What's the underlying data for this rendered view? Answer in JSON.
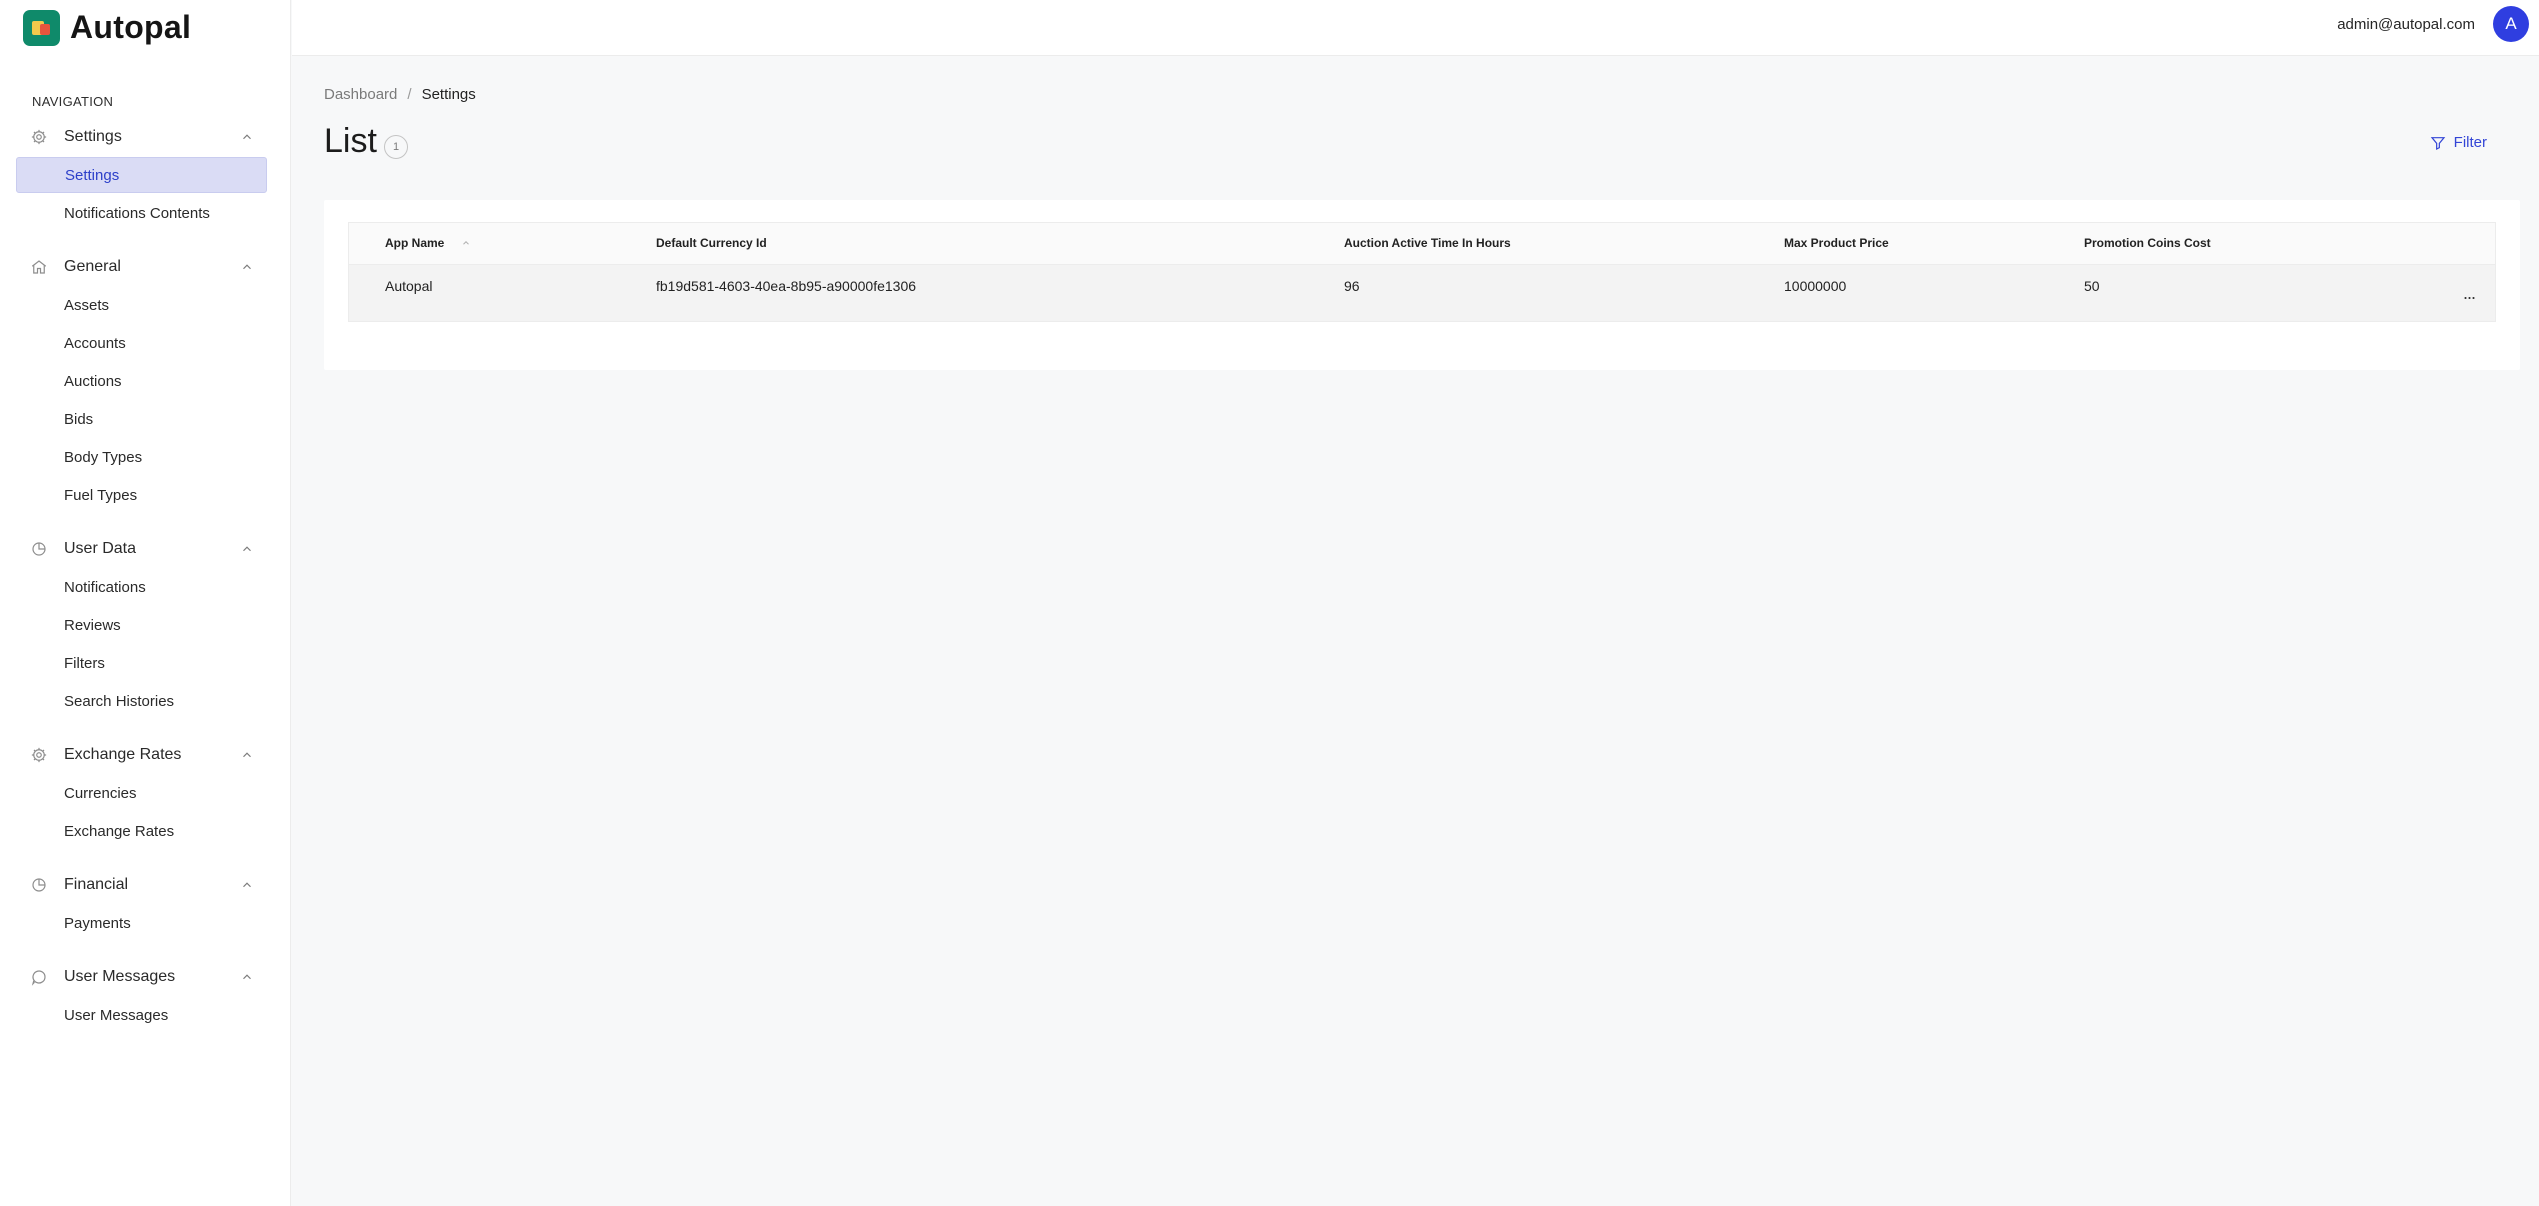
{
  "brand": {
    "name": "Autopal"
  },
  "sidebar": {
    "heading": "NAVIGATION",
    "groups": [
      {
        "label": "Settings",
        "icon": "gear-icon",
        "items": [
          "Settings",
          "Notifications Contents"
        ]
      },
      {
        "label": "General",
        "icon": "home-icon",
        "items": [
          "Assets",
          "Accounts",
          "Auctions",
          "Bids",
          "Body Types",
          "Fuel Types"
        ]
      },
      {
        "label": "User Data",
        "icon": "pie-chart-icon",
        "items": [
          "Notifications",
          "Reviews",
          "Filters",
          "Search Histories"
        ]
      },
      {
        "label": "Exchange Rates",
        "icon": "gear-icon",
        "items": [
          "Currencies",
          "Exchange Rates"
        ]
      },
      {
        "label": "Financial",
        "icon": "pie-chart-icon",
        "items": [
          "Payments"
        ]
      },
      {
        "label": "User Messages",
        "icon": "chat-icon",
        "items": [
          "User Messages"
        ]
      }
    ],
    "active_item": "Settings"
  },
  "topbar": {
    "email": "admin@autopal.com",
    "avatar_initial": "A"
  },
  "breadcrumb": {
    "home": "Dashboard",
    "separator": "/",
    "current": "Settings"
  },
  "page": {
    "title": "List",
    "count": "1",
    "filter_label": "Filter"
  },
  "table": {
    "columns": [
      "App Name",
      "Default Currency Id",
      "Auction Active Time In Hours",
      "Max Product Price",
      "Promotion Coins Cost"
    ],
    "rows": [
      [
        "Autopal",
        "fb19d581-4603-40ea-8b95-a90000fe1306",
        "96",
        "10000000",
        "50"
      ]
    ],
    "row_menu": "..."
  },
  "colors": {
    "accent": "#3345d6",
    "active_bg": "#dadcf5",
    "avatar": "#2f3ee0"
  }
}
